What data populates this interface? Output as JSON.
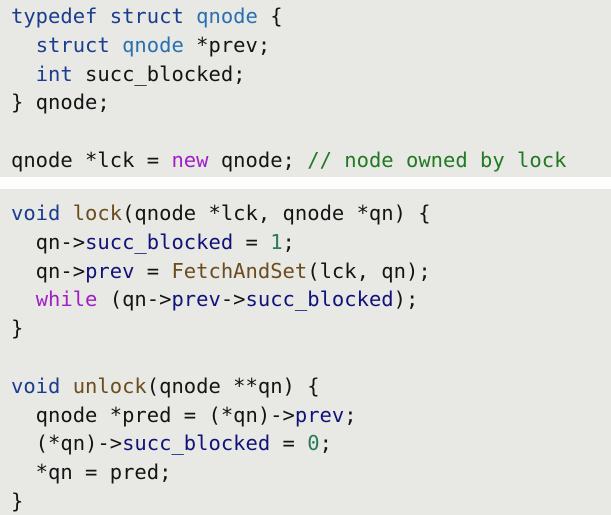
{
  "colors": {
    "background": "#e8e8e4",
    "separator": "#ffffff",
    "keyword": "#1a3d8f",
    "type": "#2a70b0",
    "control": "#a020c8",
    "comment": "#217a21",
    "function": "#6b4c1e",
    "field": "#10127a",
    "number": "#2b7b5a",
    "plain": "#141414"
  },
  "blocks": [
    {
      "lines": [
        [
          {
            "t": "typedef",
            "k": "kw"
          },
          {
            "t": " "
          },
          {
            "t": "struct",
            "k": "kw"
          },
          {
            "t": " "
          },
          {
            "t": "qnode",
            "k": "type"
          },
          {
            "t": " {"
          }
        ],
        [
          {
            "t": "  "
          },
          {
            "t": "struct",
            "k": "kw"
          },
          {
            "t": " "
          },
          {
            "t": "qnode",
            "k": "type"
          },
          {
            "t": " *prev;"
          }
        ],
        [
          {
            "t": "  "
          },
          {
            "t": "int",
            "k": "kw"
          },
          {
            "t": " succ_blocked;"
          }
        ],
        [
          {
            "t": "} qnode;"
          }
        ],
        [],
        [
          {
            "t": "qnode *lck = "
          },
          {
            "t": "new",
            "k": "magenta"
          },
          {
            "t": " qnode; "
          },
          {
            "t": "// node owned by lock",
            "k": "green"
          }
        ]
      ]
    },
    {
      "lines": [
        [
          {
            "t": "void",
            "k": "kw"
          },
          {
            "t": " "
          },
          {
            "t": "lock",
            "k": "fn"
          },
          {
            "t": "(qnode *lck, qnode *qn) {"
          }
        ],
        [
          {
            "t": "  qn->"
          },
          {
            "t": "succ_blocked",
            "k": "field"
          },
          {
            "t": " = "
          },
          {
            "t": "1",
            "k": "num"
          },
          {
            "t": ";"
          }
        ],
        [
          {
            "t": "  qn->"
          },
          {
            "t": "prev",
            "k": "field"
          },
          {
            "t": " = "
          },
          {
            "t": "FetchAndSet",
            "k": "fn"
          },
          {
            "t": "(lck, qn);"
          }
        ],
        [
          {
            "t": "  "
          },
          {
            "t": "while",
            "k": "magenta"
          },
          {
            "t": " (qn->"
          },
          {
            "t": "prev",
            "k": "field"
          },
          {
            "t": "->"
          },
          {
            "t": "succ_blocked",
            "k": "field"
          },
          {
            "t": ");"
          }
        ],
        [
          {
            "t": "}"
          }
        ],
        [],
        [
          {
            "t": "void",
            "k": "kw"
          },
          {
            "t": " "
          },
          {
            "t": "unlock",
            "k": "fn"
          },
          {
            "t": "(qnode **qn) {"
          }
        ],
        [
          {
            "t": "  qnode *pred = (*qn)->"
          },
          {
            "t": "prev",
            "k": "field"
          },
          {
            "t": ";"
          }
        ],
        [
          {
            "t": "  (*qn)->"
          },
          {
            "t": "succ_blocked",
            "k": "field"
          },
          {
            "t": " = "
          },
          {
            "t": "0",
            "k": "num"
          },
          {
            "t": ";"
          }
        ],
        [
          {
            "t": "  *qn = pred;"
          }
        ],
        [
          {
            "t": "}"
          }
        ]
      ]
    }
  ]
}
